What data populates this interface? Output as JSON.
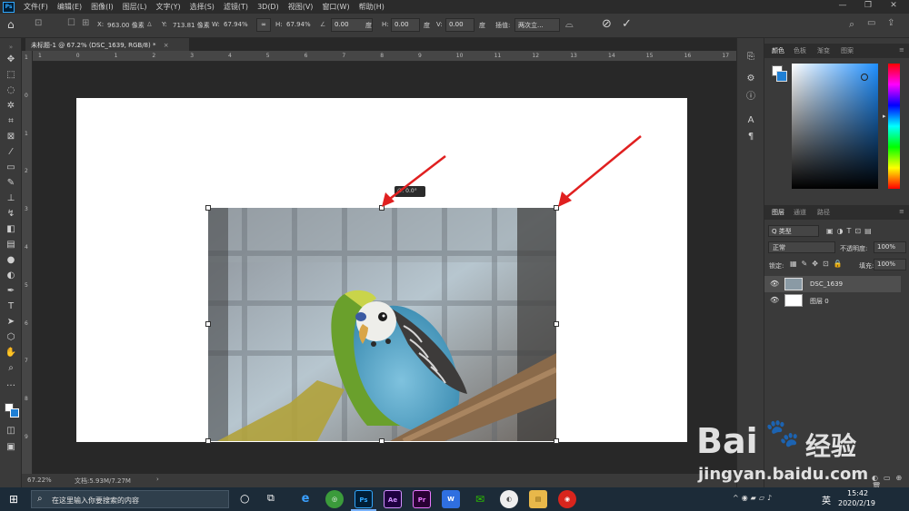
{
  "menubar": {
    "app_icon": "Ps",
    "items": [
      "文件(F)",
      "编辑(E)",
      "图像(I)",
      "图层(L)",
      "文字(Y)",
      "选择(S)",
      "滤镜(T)",
      "3D(D)",
      "视图(V)",
      "窗口(W)",
      "帮助(H)"
    ],
    "minimize": "—",
    "restore": "❐",
    "close": "✕"
  },
  "options": {
    "x_label": "X:",
    "x_value": "963.00 像素",
    "y_label": "Y:",
    "y_value": "713.81 像素",
    "w_label": "W:",
    "w_value": "67.94%",
    "h_label": "H:",
    "h_value": "67.94%",
    "angle_value": "0.00",
    "angle_unit": "度",
    "hskew_label": "H:",
    "hskew_value": "0.00",
    "hskew_unit": "度",
    "vskew_label": "V:",
    "vskew_value": "0.00",
    "vskew_unit": "度",
    "interp_label": "插值:",
    "interp_value": "两次立...",
    "cancel_icon": "⊘",
    "commit_icon": "✓"
  },
  "document": {
    "tab_title": "未标题-1 @ 67.2% (DSC_1639, RGB/8) *",
    "tab_close": "×",
    "angle_tooltip": "∅: 0.0°"
  },
  "ruler": {
    "h_ticks": [
      "1",
      "0",
      "1",
      "2",
      "3",
      "4",
      "5",
      "6",
      "7",
      "8",
      "9",
      "10",
      "11",
      "12",
      "13",
      "14",
      "15",
      "16",
      "17"
    ],
    "v_ticks": [
      "1",
      "0",
      "1",
      "2",
      "3",
      "4",
      "5",
      "6",
      "7",
      "8",
      "9"
    ]
  },
  "status": {
    "zoom": "67.22%",
    "doc_size": "文档:5.93M/7.27M",
    "arrow": "›"
  },
  "color_panel": {
    "tabs": [
      "颜色",
      "色板",
      "渐变",
      "图案"
    ],
    "fg_color": "#ffffff",
    "bg_color": "#1f7fd4"
  },
  "layers_panel": {
    "tabs": [
      "图层",
      "通道",
      "路径"
    ],
    "filter_label": "Q 类型",
    "blend_mode": "正常",
    "opacity_label": "不透明度:",
    "opacity_value": "100%",
    "lock_label": "锁定:",
    "fill_label": "填充:",
    "fill_value": "100%",
    "layers": [
      {
        "name": "DSC_1639",
        "selected": true
      },
      {
        "name": "图层 0",
        "selected": false
      }
    ]
  },
  "taskbar": {
    "search_placeholder": "在这里输入你要搜索的内容",
    "apps": [
      "e",
      "◎",
      "Ps",
      "Ae",
      "Pr",
      "W",
      "✉",
      "◐",
      "▤",
      "◉"
    ],
    "lang": "英",
    "time": "15:42",
    "date": "2020/2/19"
  },
  "watermark": {
    "brand": "Bai",
    "brand_cn": "经验",
    "url": "jingyan.baidu.com"
  },
  "colors": {
    "accent": "#31a8ff",
    "annotation_arrow": "#e02020"
  }
}
